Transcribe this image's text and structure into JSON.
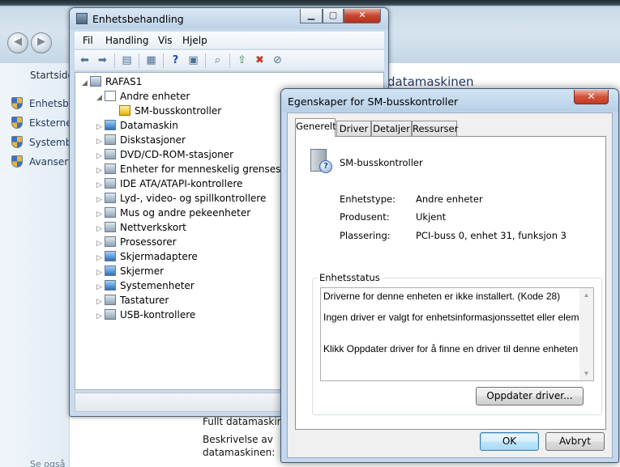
{
  "background": {
    "left_title": "Startside",
    "left_links": [
      "Enhetsbe",
      "Eksterne",
      "Systembe",
      "Avansert"
    ],
    "left_bottom": "Se også",
    "heading_partial": "datamaskinen",
    "right_labels": [
      "Fullt datamaskinn",
      "Beskrivelse av",
      "datamaskinen:"
    ],
    "right_hints": [
      "e",
      "e"
    ]
  },
  "device_manager": {
    "title": "Enhetsbehandling",
    "caption_buttons": {
      "minimize": "▁",
      "maximize": "▢",
      "close": "✕"
    },
    "menu": [
      "Fil",
      "Handling",
      "Vis",
      "Hjelp"
    ],
    "toolbar_icons": [
      "back-arrow-icon",
      "forward-arrow-icon",
      "show-hide-icon",
      "properties-icon",
      "help-icon",
      "view-icon",
      "scan-icon",
      "update-driver-icon",
      "uninstall-icon",
      "disable-icon"
    ],
    "tree": {
      "root": "RAFAS1",
      "items": [
        {
          "label": "Andre enheter",
          "expanded": true,
          "icon": "question-device-icon"
        },
        {
          "label": "SM-busskontroller",
          "child": true,
          "icon": "warning-device-icon"
        },
        {
          "label": "Datamaskin",
          "icon": "computer-icon"
        },
        {
          "label": "Diskstasjoner",
          "icon": "disk-icon"
        },
        {
          "label": "DVD/CD-ROM-stasjoner",
          "icon": "cdrom-icon"
        },
        {
          "label": "Enheter for menneskelig grensesnitt",
          "icon": "hid-icon"
        },
        {
          "label": "IDE ATA/ATAPI-kontrollere",
          "icon": "ide-icon"
        },
        {
          "label": "Lyd-, video- og spillkontrollere",
          "icon": "sound-icon"
        },
        {
          "label": "Mus og andre pekeenheter",
          "icon": "mouse-icon"
        },
        {
          "label": "Nettverkskort",
          "icon": "network-icon"
        },
        {
          "label": "Prosessorer",
          "icon": "processor-icon"
        },
        {
          "label": "Skjermadaptere",
          "icon": "display-adapter-icon"
        },
        {
          "label": "Skjermer",
          "icon": "monitor-icon"
        },
        {
          "label": "Systemenheter",
          "icon": "system-icon"
        },
        {
          "label": "Tastaturer",
          "icon": "keyboard-icon"
        },
        {
          "label": "USB-kontrollere",
          "icon": "usb-icon"
        }
      ]
    }
  },
  "properties_dialog": {
    "title": "Egenskaper for SM-busskontroller",
    "close": "✕",
    "tabs": [
      "Generelt",
      "Driver",
      "Detaljer",
      "Ressurser"
    ],
    "active_tab": "Generelt",
    "device_name": "SM-busskontroller",
    "fields": [
      {
        "label": "Enhetstype:",
        "value": "Andre enheter"
      },
      {
        "label": "Produsent:",
        "value": "Ukjent"
      },
      {
        "label": "Plassering:",
        "value": "PCI-buss 0, enhet 31, funksjon 3"
      }
    ],
    "status_legend": "Enhetsstatus",
    "status_lines": [
      "Driverne for denne enheten er ikke installert. (Kode 28)",
      "Ingen driver er valgt for enhetsinformasjonssettet eller elementet.",
      "Klikk Oppdater driver for å finne en driver til denne enheten."
    ],
    "update_button": "Oppdater driver...",
    "ok_button": "OK",
    "cancel_button": "Avbryt"
  },
  "colors": {
    "accent": "#3c7fb1",
    "window_frame": "#c3d8ed",
    "close_red": "#c8452d"
  }
}
